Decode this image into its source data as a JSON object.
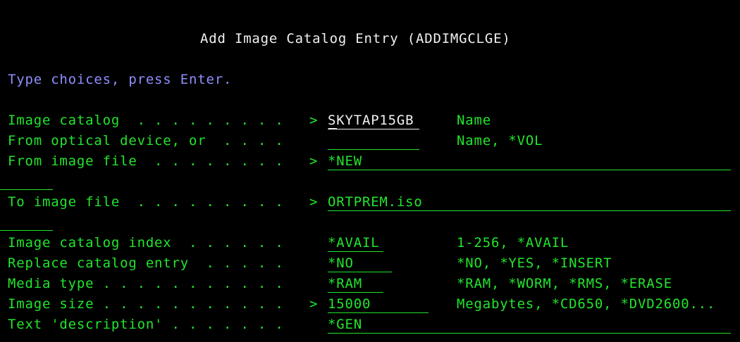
{
  "screen": {
    "title": "Add Image Catalog Entry (ADDIMGCLGE)",
    "instruction": "Type choices, press Enter.",
    "colors": {
      "background": "#000000",
      "text_green": "#22e52c",
      "title_white": "#f0f0f0",
      "instruction_blue": "#8f8fff"
    }
  },
  "rows": [
    {
      "label": "Image catalog  . . . . . . . . .",
      "prompt": ">",
      "value": "SKYTAP15GB",
      "hint": "Name"
    },
    {
      "label": "From optical device, or  . . . .",
      "prompt": "",
      "value": "",
      "hint": "Name, *VOL"
    },
    {
      "label": "From image file  . . . . . . . .",
      "prompt": ">",
      "value": "*NEW",
      "hint": ""
    },
    {
      "label": "To image file  . . . . . . . . .",
      "prompt": ">",
      "value": "ORTPREM.iso",
      "hint": ""
    },
    {
      "label": "Image catalog index  . . . . . .",
      "prompt": "",
      "value": "*AVAIL",
      "hint": "1-256, *AVAIL"
    },
    {
      "label": "Replace catalog entry  . . . . .",
      "prompt": "",
      "value": "*NO",
      "hint": "*NO, *YES, *INSERT"
    },
    {
      "label": "Media type . . . . . . . . . . .",
      "prompt": "",
      "value": "*RAM",
      "hint": "*RAM, *WORM, *RMS, *ERASE"
    },
    {
      "label": "Image size . . . . . . . . . . .",
      "prompt": ">",
      "value": "15000",
      "hint": "Megabytes, *CD650, *DVD2600..."
    },
    {
      "label": "Text 'description' . . . . . . .",
      "prompt": "",
      "value": "*GEN",
      "hint": ""
    }
  ]
}
